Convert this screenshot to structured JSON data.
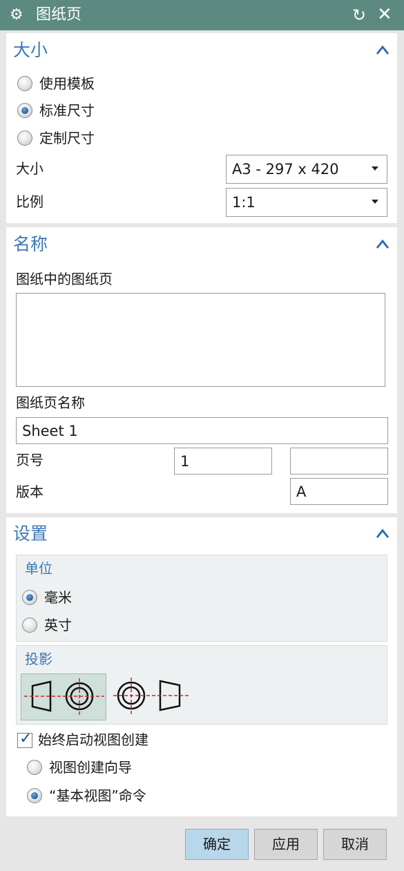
{
  "window": {
    "title": "图纸页"
  },
  "size_section": {
    "title": "大小",
    "options": [
      {
        "label": "使用模板",
        "selected": false
      },
      {
        "label": "标准尺寸",
        "selected": true
      },
      {
        "label": "定制尺寸",
        "selected": false
      }
    ],
    "size_label": "大小",
    "size_value": "A3 - 297 x 420",
    "scale_label": "比例",
    "scale_value": "1:1"
  },
  "name_section": {
    "title": "名称",
    "sheets_in_drawing_label": "图纸中的图纸页",
    "sheet_name_label": "图纸页名称",
    "sheet_name_value": "Sheet 1",
    "page_number_label": "页号",
    "page_number_value": "1",
    "page_number_suffix": "",
    "revision_label": "版本",
    "revision_value": "A"
  },
  "settings_section": {
    "title": "设置",
    "units_title": "单位",
    "units": [
      {
        "label": "毫米",
        "selected": true
      },
      {
        "label": "英寸",
        "selected": false
      }
    ],
    "projection_title": "投影",
    "projection_selected": "first-angle",
    "always_start_view_creation_label": "始终启动视图创建",
    "always_start_view_creation_checked": true,
    "view_options": [
      {
        "label": "视图创建向导",
        "selected": false
      },
      {
        "label": "“基本视图”命令",
        "selected": true
      }
    ]
  },
  "buttons": {
    "ok": "确定",
    "apply": "应用",
    "cancel": "取消"
  }
}
